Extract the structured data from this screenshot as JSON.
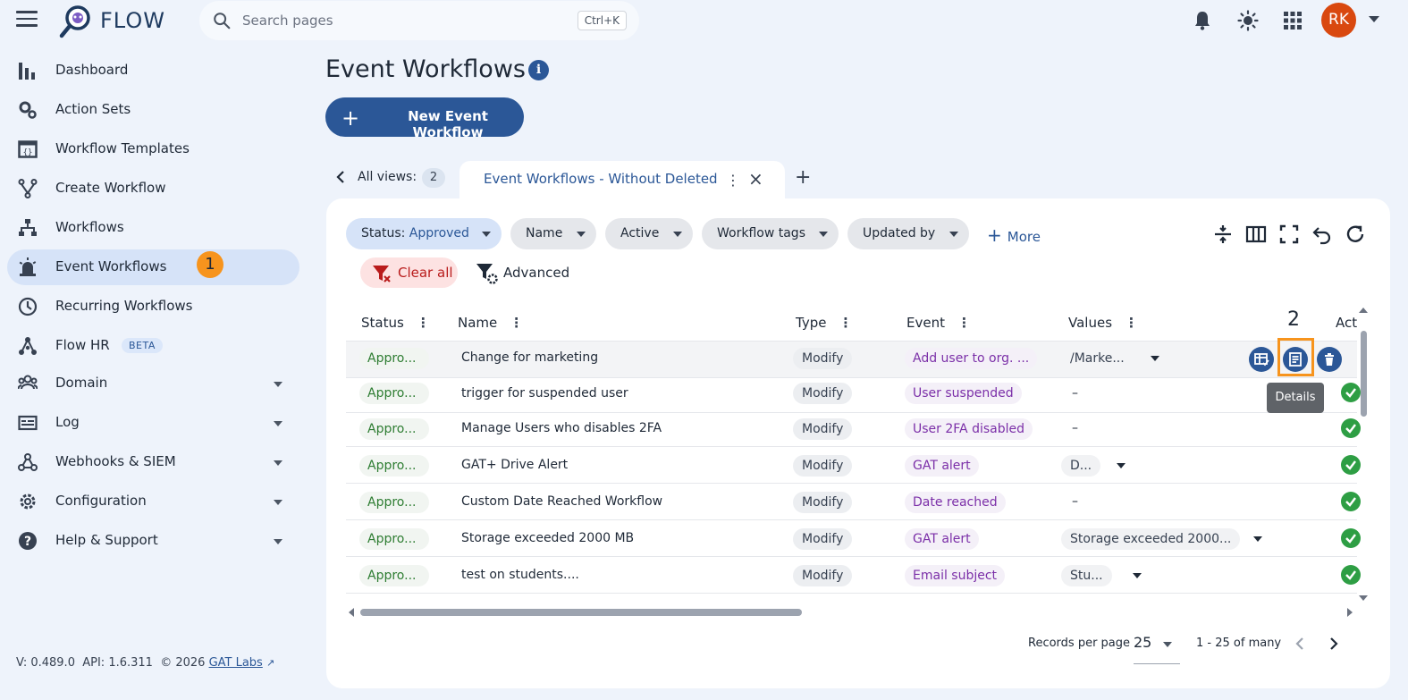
{
  "brand": "FLOW",
  "search": {
    "placeholder": "Search pages",
    "shortcut": "Ctrl+K"
  },
  "user": {
    "initials": "RK"
  },
  "topbar_icons": [
    "bell-icon",
    "brightness-icon",
    "apps-grid-icon"
  ],
  "sidebar": {
    "items": [
      {
        "label": "Dashboard",
        "icon": "bar-chart-icon"
      },
      {
        "label": "Action Sets",
        "icon": "gears-icon"
      },
      {
        "label": "Workflow Templates",
        "icon": "template-icon"
      },
      {
        "label": "Create Workflow",
        "icon": "branch-icon"
      },
      {
        "label": "Workflows",
        "icon": "hierarchy-icon"
      },
      {
        "label": "Event Workflows",
        "icon": "alarm-light-icon",
        "active": true
      },
      {
        "label": "Recurring Workflows",
        "icon": "clock-icon"
      },
      {
        "label": "Flow HR",
        "icon": "network-icon",
        "badge": "BETA"
      },
      {
        "label": "Domain",
        "icon": "users-icon",
        "expandable": true
      },
      {
        "label": "Log",
        "icon": "log-icon",
        "expandable": true
      },
      {
        "label": "Webhooks & SIEM",
        "icon": "webhook-icon",
        "expandable": true
      },
      {
        "label": "Configuration",
        "icon": "gear-icon",
        "expandable": true
      },
      {
        "label": "Help & Support",
        "icon": "help-icon",
        "expandable": true
      }
    ]
  },
  "annotations": {
    "step1": "1",
    "step2": "2"
  },
  "footer": {
    "version": "V: 0.489.0",
    "api": "API: 1.6.311",
    "copyright": "© 2026",
    "link": "GAT Labs"
  },
  "page": {
    "title": "Event Workflows",
    "new_button": "New Event Workflow"
  },
  "views": {
    "label": "All views:",
    "count": "2",
    "active_tab": "Event Workflows - Without Deleted"
  },
  "filters": {
    "status_label": "Status:",
    "status_value": "Approved",
    "chips": [
      "Name",
      "Active",
      "Workflow tags",
      "Updated by"
    ],
    "more": "More",
    "clear_all": "Clear all",
    "advanced": "Advanced"
  },
  "table": {
    "columns": [
      "Status",
      "Name",
      "Type",
      "Event",
      "Values",
      "Act"
    ],
    "rows": [
      {
        "status": "Appro...",
        "name": "Change for marketing",
        "type": "Modify",
        "event": "Add user to org. ...",
        "value": "/Marke...",
        "has_dropdown": true
      },
      {
        "status": "Appro...",
        "name": "trigger for suspended user",
        "type": "Modify",
        "event": "User suspended",
        "value": "–",
        "has_dropdown": false
      },
      {
        "status": "Appro...",
        "name": "Manage Users who disables 2FA",
        "type": "Modify",
        "event": "User 2FA disabled",
        "value": "–",
        "has_dropdown": false
      },
      {
        "status": "Appro...",
        "name": "GAT+ Drive Alert",
        "type": "Modify",
        "event": "GAT alert",
        "value": "D...",
        "has_dropdown": true
      },
      {
        "status": "Appro...",
        "name": "Custom Date Reached Workflow",
        "type": "Modify",
        "event": "Date reached",
        "value": "–",
        "has_dropdown": false
      },
      {
        "status": "Appro...",
        "name": "Storage exceeded 2000 MB",
        "type": "Modify",
        "event": "GAT alert",
        "value": "Storage exceeded 2000...",
        "has_dropdown": true
      },
      {
        "status": "Appro...",
        "name": "test on students....",
        "type": "Modify",
        "event": "Email subject",
        "value": "Stu...",
        "has_dropdown": true
      }
    ],
    "tooltip": "Details"
  },
  "pagination": {
    "records_label": "Records per page",
    "per_page": "25",
    "range": "1 - 25 of many"
  },
  "colors": {
    "primary": "#2b5797",
    "accent_orange": "#f7941d",
    "success": "#2e9e44",
    "event_purple": "#7b2fa8",
    "danger": "#b91c1c"
  }
}
